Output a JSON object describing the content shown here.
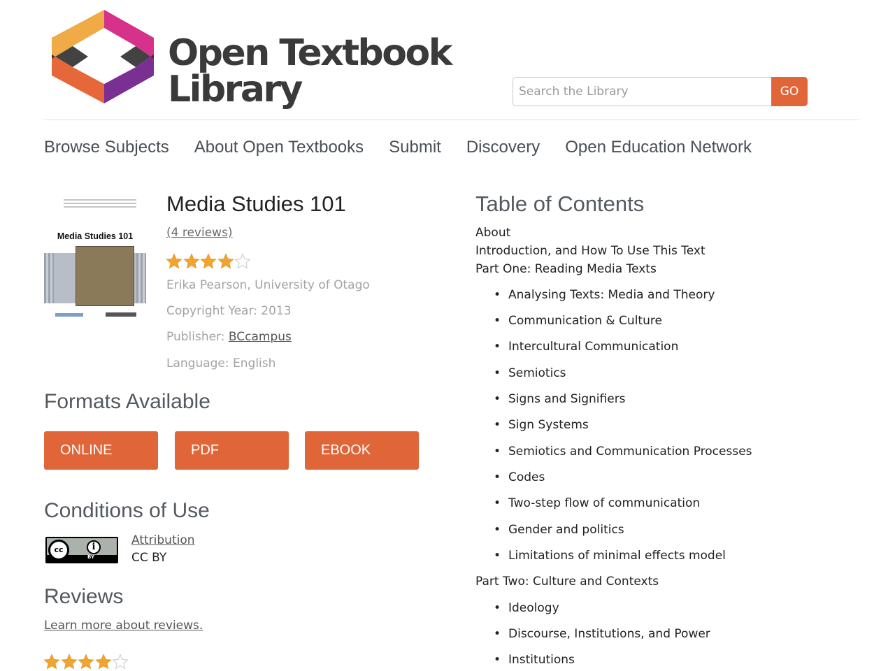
{
  "site": {
    "logo_line1": "Open Textbook",
    "logo_line2": "Library",
    "logo_colors": [
      "#f0ab47",
      "#e5673a",
      "#d6328b",
      "#7a2f93"
    ],
    "accent_color": "#e0663a"
  },
  "search": {
    "placeholder": "Search the Library",
    "value": "",
    "button_label": "GO"
  },
  "nav": {
    "items": [
      "Browse Subjects",
      "About Open Textbooks",
      "Submit",
      "Discovery",
      "Open Education Network"
    ]
  },
  "book": {
    "cover_title": "Media Studies 101",
    "title": "Media Studies 101",
    "reviews_link": "(4 reviews)",
    "rating_stars": 4,
    "rating_max": 5,
    "author": "Erika Pearson, University of Otago",
    "copyright": "Copyright Year: 2013",
    "publisher_label": "Publisher: ",
    "publisher": "BCcampus",
    "language": "Language: English"
  },
  "formats": {
    "heading": "Formats Available",
    "buttons": [
      "ONLINE",
      "PDF",
      "EBOOK"
    ]
  },
  "conditions": {
    "heading": "Conditions of Use",
    "license_link": "Attribution",
    "license_code": "CC BY",
    "badge_text": "BY",
    "badge_cc": "cc",
    "badge_icon": "person-icon"
  },
  "reviews": {
    "heading": "Reviews",
    "learn_link": "Learn more about reviews.",
    "rating_stars": 4
  },
  "toc": {
    "heading": "Table of Contents",
    "entries": [
      {
        "type": "part",
        "text": "About"
      },
      {
        "type": "part",
        "text": "Introduction, and How To Use This Text"
      },
      {
        "type": "part",
        "text": "Part One: Reading Media Texts"
      },
      {
        "type": "item",
        "text": "Analysing Texts: Media and Theory"
      },
      {
        "type": "item",
        "text": "Communication & Culture"
      },
      {
        "type": "item",
        "text": "Intercultural Communication"
      },
      {
        "type": "item",
        "text": "Semiotics"
      },
      {
        "type": "item",
        "text": "Signs and Signifiers"
      },
      {
        "type": "item",
        "text": "Sign Systems"
      },
      {
        "type": "item",
        "text": "Semiotics and Communication Processes"
      },
      {
        "type": "item",
        "text": "Codes"
      },
      {
        "type": "item",
        "text": "Two-step flow of communication"
      },
      {
        "type": "item",
        "text": "Gender and politics"
      },
      {
        "type": "item",
        "text": "Limitations of minimal effects model"
      },
      {
        "type": "part",
        "text": "Part Two: Culture and Contexts"
      },
      {
        "type": "item",
        "text": "Ideology"
      },
      {
        "type": "item",
        "text": "Discourse, Institutions, and Power"
      },
      {
        "type": "item",
        "text": "Institutions"
      }
    ]
  }
}
